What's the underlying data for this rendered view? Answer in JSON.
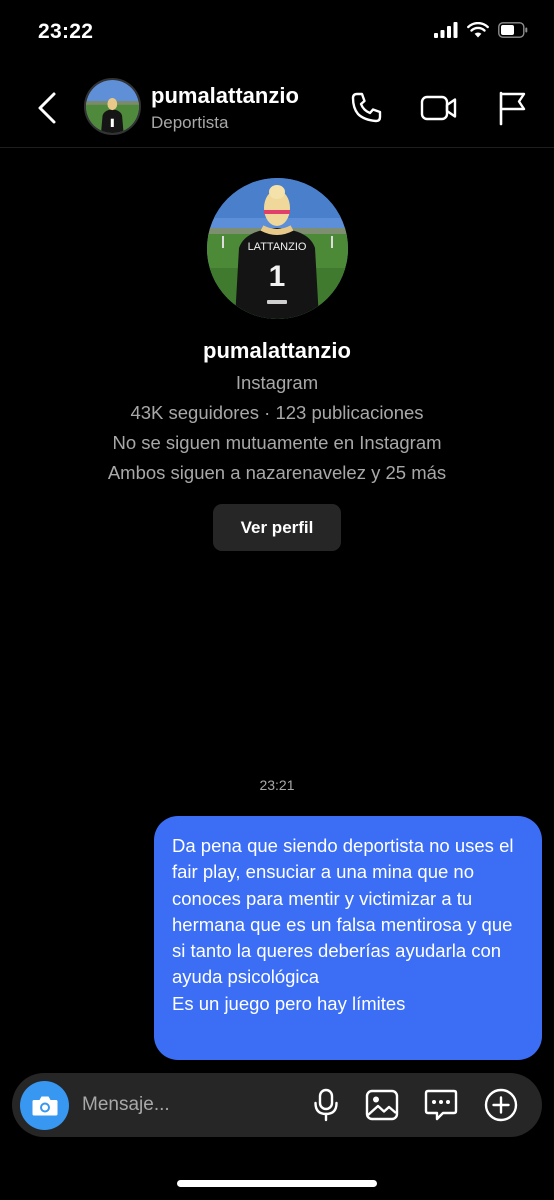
{
  "status_bar": {
    "time": "23:22",
    "icons": [
      "cellular-signal-icon",
      "wifi-icon",
      "battery-icon"
    ]
  },
  "header": {
    "username": "pumalattanzio",
    "subtitle": "Deportista",
    "icons": [
      "back-chevron-icon",
      "phone-icon",
      "video-camera-icon",
      "flag-icon"
    ]
  },
  "profile": {
    "username": "pumalattanzio",
    "platform": "Instagram",
    "stats": "43K seguidores · 123 publicaciones",
    "follow_status": "No se siguen mutuamente en Instagram",
    "mutuals": "Ambos siguen a nazarenavelez y 25 más",
    "view_profile_label": "Ver perfil",
    "jersey_name": "LATTANZIO",
    "jersey_number": "1"
  },
  "conversation": {
    "timestamp": "23:21",
    "messages": [
      {
        "direction": "outgoing",
        "lines": [
          "Da pena que siendo deportista no uses el fair play, ensuciar a una mina que no conoces para mentir y victimizar a tu hermana que es un falsa mentirosa y que si tanto la queres deberías ayudarla con ayuda psicológica",
          "Es un juego pero hay límites"
        ]
      }
    ]
  },
  "composer": {
    "placeholder": "Mensaje...",
    "icons": [
      "camera-icon",
      "microphone-icon",
      "gallery-icon",
      "sticker-icon",
      "plus-icon"
    ]
  },
  "colors": {
    "background": "#000000",
    "bubble": "#3b6ef5",
    "camera_button": "#3897f0",
    "secondary_text": "#a8a8a8",
    "surface": "#262626"
  }
}
